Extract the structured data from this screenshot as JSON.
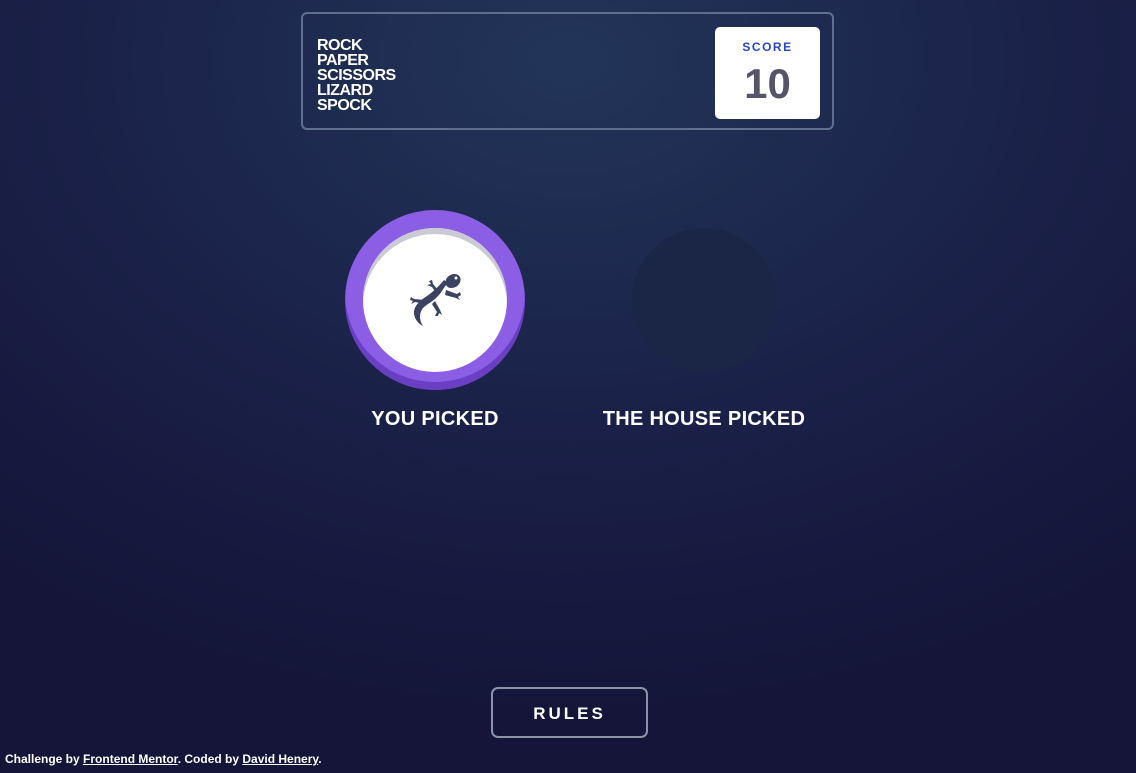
{
  "header": {
    "title_lines": [
      "ROCK",
      "PAPER",
      "SCISSORS",
      "LIZARD",
      "SPOCK"
    ],
    "score_label": "SCORE",
    "score_value": "10"
  },
  "game": {
    "player": {
      "choice_icon": "lizard-icon",
      "label": "YOU PICKED",
      "ring_color": "#8c5de5"
    },
    "house": {
      "choice_icon": "",
      "label": "THE HOUSE PICKED"
    }
  },
  "rules_button": {
    "label": "RULES"
  },
  "attribution": {
    "prefix": "Challenge by ",
    "link1": "Frontend Mentor",
    "middle": ". Coded by ",
    "link2": "David Henery",
    "suffix": "."
  }
}
